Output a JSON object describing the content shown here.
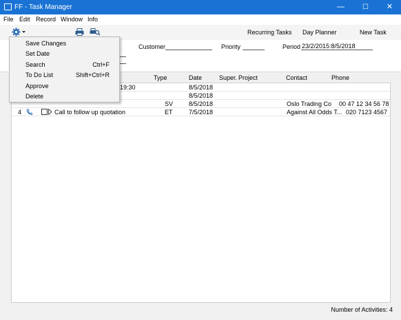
{
  "window": {
    "title": "FF - Task Manager",
    "minimize": "—",
    "maximize": "☐",
    "close": "✕"
  },
  "menubar": {
    "items": [
      "File",
      "Edit",
      "Record",
      "Window",
      "Info"
    ]
  },
  "toolbar": {
    "gear_icon": "gear-icon",
    "print_icon": "printer-icon",
    "print_preview_icon": "print-preview-icon",
    "recurring": "Recurring Tasks",
    "day_planner": "Day Planner",
    "new_task": "New Task"
  },
  "filters": {
    "customer_label": "Customer",
    "customer_value": "",
    "priority_label": "Priority",
    "priority_value": "",
    "period_label": "Period",
    "period_value": "23/2/2015:8/5/2018"
  },
  "columns": {
    "type": "Type",
    "date": "Date",
    "super": "Super.",
    "project": "Project",
    "contact": "Contact",
    "phone": "Phone"
  },
  "rows": [
    {
      "num": "",
      "subject": "19:30",
      "type": "",
      "date": "8/5/2018",
      "contact": "",
      "phone": ""
    },
    {
      "num": "",
      "subject": "",
      "type": "",
      "date": "8/5/2018",
      "contact": "",
      "phone": ""
    },
    {
      "num": "",
      "subject": "",
      "type": "SV",
      "date": "8/5/2018",
      "contact": "Oslo Trading Co",
      "phone": "00 47 12 34 56 78"
    },
    {
      "num": "4",
      "subject": "Call to follow up quotation",
      "type": "ET",
      "date": "7/5/2018",
      "contact": "Against All Odds T...",
      "phone": "020 7123 4567"
    }
  ],
  "context_menu": [
    {
      "label": "Save Changes",
      "shortcut": ""
    },
    {
      "label": "Set Date",
      "shortcut": ""
    },
    {
      "label": "Search",
      "shortcut": "Ctrl+F"
    },
    {
      "label": "To Do List",
      "shortcut": "Shift+Ctrl+R"
    },
    {
      "label": "Approve",
      "shortcut": ""
    },
    {
      "label": "Delete",
      "shortcut": ""
    }
  ],
  "status": "Number of Activities: 4",
  "colors": {
    "titlebar": "#1a73d4",
    "accent_icon": "#2a6fb5"
  }
}
